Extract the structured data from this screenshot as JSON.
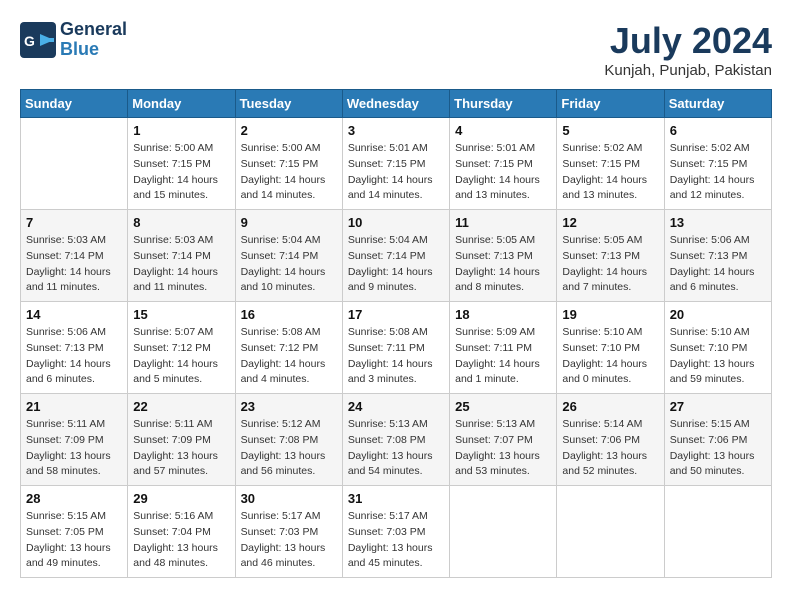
{
  "header": {
    "logo_line1": "General",
    "logo_line2": "Blue",
    "title": "July 2024",
    "location": "Kunjah, Punjab, Pakistan"
  },
  "columns": [
    "Sunday",
    "Monday",
    "Tuesday",
    "Wednesday",
    "Thursday",
    "Friday",
    "Saturday"
  ],
  "weeks": [
    [
      {
        "num": "",
        "info": ""
      },
      {
        "num": "1",
        "info": "Sunrise: 5:00 AM\nSunset: 7:15 PM\nDaylight: 14 hours\nand 15 minutes."
      },
      {
        "num": "2",
        "info": "Sunrise: 5:00 AM\nSunset: 7:15 PM\nDaylight: 14 hours\nand 14 minutes."
      },
      {
        "num": "3",
        "info": "Sunrise: 5:01 AM\nSunset: 7:15 PM\nDaylight: 14 hours\nand 14 minutes."
      },
      {
        "num": "4",
        "info": "Sunrise: 5:01 AM\nSunset: 7:15 PM\nDaylight: 14 hours\nand 13 minutes."
      },
      {
        "num": "5",
        "info": "Sunrise: 5:02 AM\nSunset: 7:15 PM\nDaylight: 14 hours\nand 13 minutes."
      },
      {
        "num": "6",
        "info": "Sunrise: 5:02 AM\nSunset: 7:15 PM\nDaylight: 14 hours\nand 12 minutes."
      }
    ],
    [
      {
        "num": "7",
        "info": "Sunrise: 5:03 AM\nSunset: 7:14 PM\nDaylight: 14 hours\nand 11 minutes."
      },
      {
        "num": "8",
        "info": "Sunrise: 5:03 AM\nSunset: 7:14 PM\nDaylight: 14 hours\nand 11 minutes."
      },
      {
        "num": "9",
        "info": "Sunrise: 5:04 AM\nSunset: 7:14 PM\nDaylight: 14 hours\nand 10 minutes."
      },
      {
        "num": "10",
        "info": "Sunrise: 5:04 AM\nSunset: 7:14 PM\nDaylight: 14 hours\nand 9 minutes."
      },
      {
        "num": "11",
        "info": "Sunrise: 5:05 AM\nSunset: 7:13 PM\nDaylight: 14 hours\nand 8 minutes."
      },
      {
        "num": "12",
        "info": "Sunrise: 5:05 AM\nSunset: 7:13 PM\nDaylight: 14 hours\nand 7 minutes."
      },
      {
        "num": "13",
        "info": "Sunrise: 5:06 AM\nSunset: 7:13 PM\nDaylight: 14 hours\nand 6 minutes."
      }
    ],
    [
      {
        "num": "14",
        "info": "Sunrise: 5:06 AM\nSunset: 7:13 PM\nDaylight: 14 hours\nand 6 minutes."
      },
      {
        "num": "15",
        "info": "Sunrise: 5:07 AM\nSunset: 7:12 PM\nDaylight: 14 hours\nand 5 minutes."
      },
      {
        "num": "16",
        "info": "Sunrise: 5:08 AM\nSunset: 7:12 PM\nDaylight: 14 hours\nand 4 minutes."
      },
      {
        "num": "17",
        "info": "Sunrise: 5:08 AM\nSunset: 7:11 PM\nDaylight: 14 hours\nand 3 minutes."
      },
      {
        "num": "18",
        "info": "Sunrise: 5:09 AM\nSunset: 7:11 PM\nDaylight: 14 hours\nand 1 minute."
      },
      {
        "num": "19",
        "info": "Sunrise: 5:10 AM\nSunset: 7:10 PM\nDaylight: 14 hours\nand 0 minutes."
      },
      {
        "num": "20",
        "info": "Sunrise: 5:10 AM\nSunset: 7:10 PM\nDaylight: 13 hours\nand 59 minutes."
      }
    ],
    [
      {
        "num": "21",
        "info": "Sunrise: 5:11 AM\nSunset: 7:09 PM\nDaylight: 13 hours\nand 58 minutes."
      },
      {
        "num": "22",
        "info": "Sunrise: 5:11 AM\nSunset: 7:09 PM\nDaylight: 13 hours\nand 57 minutes."
      },
      {
        "num": "23",
        "info": "Sunrise: 5:12 AM\nSunset: 7:08 PM\nDaylight: 13 hours\nand 56 minutes."
      },
      {
        "num": "24",
        "info": "Sunrise: 5:13 AM\nSunset: 7:08 PM\nDaylight: 13 hours\nand 54 minutes."
      },
      {
        "num": "25",
        "info": "Sunrise: 5:13 AM\nSunset: 7:07 PM\nDaylight: 13 hours\nand 53 minutes."
      },
      {
        "num": "26",
        "info": "Sunrise: 5:14 AM\nSunset: 7:06 PM\nDaylight: 13 hours\nand 52 minutes."
      },
      {
        "num": "27",
        "info": "Sunrise: 5:15 AM\nSunset: 7:06 PM\nDaylight: 13 hours\nand 50 minutes."
      }
    ],
    [
      {
        "num": "28",
        "info": "Sunrise: 5:15 AM\nSunset: 7:05 PM\nDaylight: 13 hours\nand 49 minutes."
      },
      {
        "num": "29",
        "info": "Sunrise: 5:16 AM\nSunset: 7:04 PM\nDaylight: 13 hours\nand 48 minutes."
      },
      {
        "num": "30",
        "info": "Sunrise: 5:17 AM\nSunset: 7:03 PM\nDaylight: 13 hours\nand 46 minutes."
      },
      {
        "num": "31",
        "info": "Sunrise: 5:17 AM\nSunset: 7:03 PM\nDaylight: 13 hours\nand 45 minutes."
      },
      {
        "num": "",
        "info": ""
      },
      {
        "num": "",
        "info": ""
      },
      {
        "num": "",
        "info": ""
      }
    ]
  ]
}
